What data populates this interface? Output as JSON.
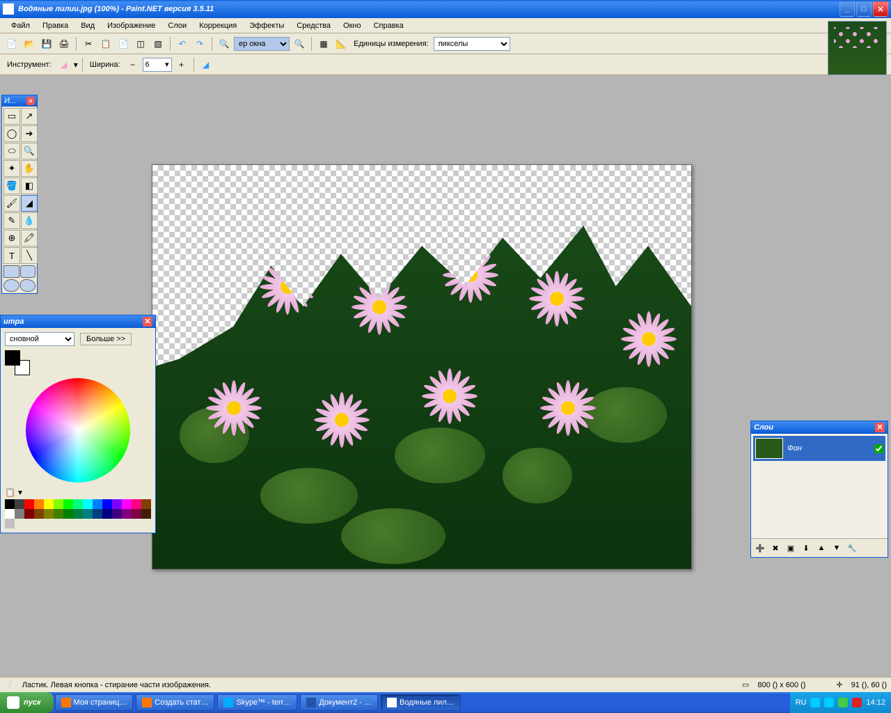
{
  "titlebar": {
    "title": "Водяные лилии.jpg (100%) - Paint.NET версия 3.5.11"
  },
  "menu": {
    "file": "Файл",
    "edit": "Правка",
    "view": "Вид",
    "image": "Изображение",
    "layers": "Слои",
    "adjust": "Коррекция",
    "effects": "Эффекты",
    "tools": "Средства",
    "window": "Окно",
    "help": "Справка"
  },
  "toolbar1": {
    "zoom_combo": "ер окна",
    "units_label": "Единицы измерения:",
    "units_value": "пикселы"
  },
  "toolbar2": {
    "tool_label": "Инструмент:",
    "width_label": "Ширина:",
    "width_value": "6"
  },
  "tools_panel": {
    "title": "И..."
  },
  "colors_panel": {
    "title": "итра",
    "mode": "сновной",
    "more": "Больше >>"
  },
  "layers_panel": {
    "title": "Слои",
    "layer0": "Фон"
  },
  "statusbar": {
    "hint": "Ластик. Левая кнопка - стирание части изображения.",
    "size": "800 () x 600 ()",
    "pos": "91 (), 60 ()"
  },
  "taskbar": {
    "start": "пуск",
    "t1": "Моя страниц…",
    "t2": "Создать стат…",
    "t3": "Skype™ - terr…",
    "t4": "Документ2 - …",
    "t5": "Водяные лил…",
    "lang": "RU",
    "clock": "14:12"
  },
  "palette_colors": [
    "#000",
    "#404040",
    "#f00",
    "#ff8000",
    "#ff0",
    "#80ff00",
    "#0f0",
    "#00ff80",
    "#0ff",
    "#0080ff",
    "#00f",
    "#8000ff",
    "#f0f",
    "#ff0080",
    "#804000",
    "#fff",
    "#808080",
    "#800000",
    "#804000",
    "#808000",
    "#408000",
    "#008000",
    "#008040",
    "#008080",
    "#004080",
    "#000080",
    "#400080",
    "#800080",
    "#800040",
    "#402000",
    "#c0c0c0"
  ]
}
